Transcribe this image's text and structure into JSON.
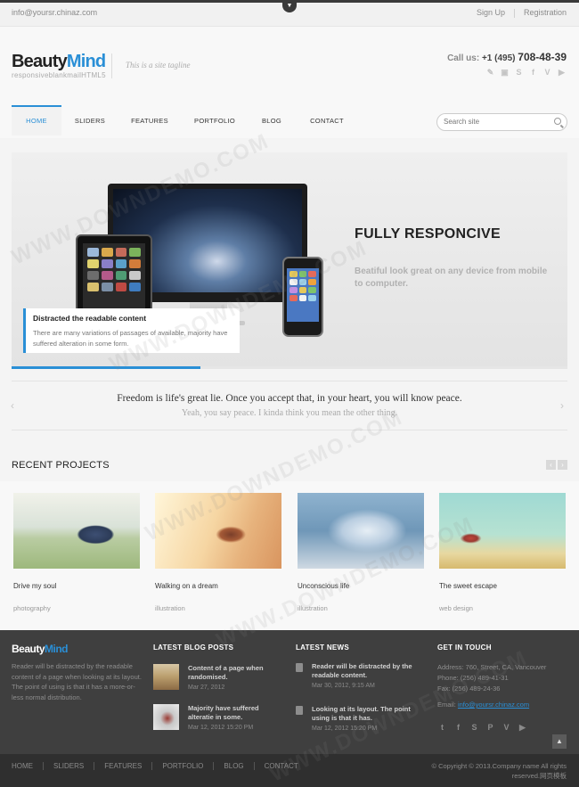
{
  "topbar": {
    "email": "info@yoursr.chinaz.com",
    "signup": "Sign Up",
    "registration": "Registration",
    "dropdown_icon": "chevron-down-icon"
  },
  "header": {
    "logo_part1": "Beauty",
    "logo_part2": "Mind",
    "logo_sub": "responsiveblankmailHTML5",
    "tagline": "This is a site tagline",
    "call_label": "Call us:",
    "call_code": "+1 (495)",
    "call_number": "708-48-39",
    "social_icons": [
      "pencil-icon",
      "chat-icon",
      "skype-icon",
      "facebook-icon",
      "vimeo-icon",
      "youtube-icon"
    ]
  },
  "nav": {
    "items": [
      "HOME",
      "SLIDERS",
      "FEATURES",
      "PORTFOLIO",
      "BLOG",
      "CONTACT"
    ],
    "active": "HOME",
    "search_placeholder": "Search site"
  },
  "slider": {
    "title": "FULLY RESPONCIVE",
    "subtitle": "Beatiful look great on any device from mobile to computer.",
    "caption_title": "Distracted the readable content",
    "caption_text": "There are many variations of passages of available, majority have suffered alteration in some form.",
    "progress_percent": 34
  },
  "quote": {
    "line1": "Freedom is life's great lie. Once you accept that, in your heart, you will know peace.",
    "line2": "Yeah, you say peace. I kinda think you mean the other thing."
  },
  "recent": {
    "title": "RECENT PROJECTS",
    "projects": [
      {
        "name": "Drive my soul",
        "category": "photography"
      },
      {
        "name": "Walking on a dream",
        "category": "illustration"
      },
      {
        "name": "Unconscious life",
        "category": "illustration"
      },
      {
        "name": "The sweet escape",
        "category": "web design"
      }
    ]
  },
  "footer": {
    "logo_part1": "Beauty",
    "logo_part2": "Mind",
    "about": "Reader will be distracted by the readable content of a page when looking at its layout. The point of using is that it has a more-or-less normal distribution.",
    "blog_heading": "LATEST BLOG POSTS",
    "blog": [
      {
        "title": "Content of a page when randomised.",
        "date": "Mar 27, 2012"
      },
      {
        "title": "Majority have suffered alteratie in some.",
        "date": "Mar 12, 2012 15:20 PM"
      }
    ],
    "news_heading": "LATEST NEWS",
    "news": [
      {
        "title": "Reader will be distracted by the readable content.",
        "date": "Mar 30, 2012, 9:15 AM"
      },
      {
        "title": "Looking at its layout. The point using is that it has.",
        "date": "Mar 12, 2012 15:20 PM"
      }
    ],
    "touch_heading": "GET IN TOUCH",
    "address": "Address: 760, Street, CA, Vancouver",
    "phone": "Phone: (256) 489-41-31",
    "fax": "Fax: (256) 489-24-36",
    "email_label": "Email:",
    "email": "info@yoursr.chinaz.com",
    "social_icons": [
      "twitter-icon",
      "facebook-icon",
      "skype-icon",
      "pinterest-icon",
      "vimeo-icon",
      "youtube-icon"
    ]
  },
  "bottom": {
    "nav": [
      "HOME",
      "SLIDERS",
      "FEATURES",
      "PORTFOLIO",
      "BLOG",
      "CONTACT"
    ],
    "copyright": "© Copyright © 2013.Company name All rights reserved.网页模板"
  },
  "watermark": "WWW.DOWNDEMO.COM",
  "colors": {
    "accent": "#2a8fd6",
    "footer_bg": "#3f3f3f",
    "bottombar_bg": "#2f2f2f"
  }
}
